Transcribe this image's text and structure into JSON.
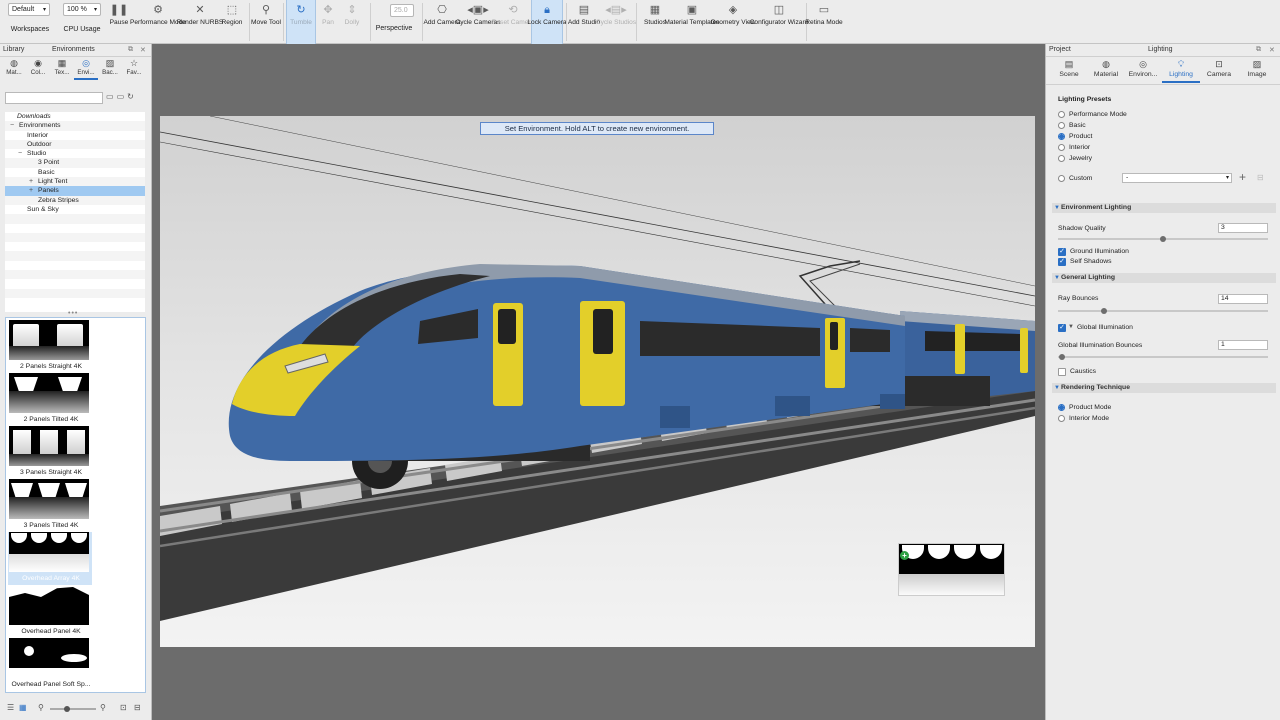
{
  "toolbar": {
    "workspace_value": "Default",
    "workspace_label": "Workspaces",
    "cpu_value": "100 %",
    "cpu_label": "CPU Usage",
    "pause": "Pause",
    "performance_mode": "Performance Mode",
    "render_nurbs": "Render NURBS",
    "region": "Region",
    "move_tool": "Move Tool",
    "tumble": "Tumble",
    "pan": "Pan",
    "dolly": "Dolly",
    "fov_value": "25.0",
    "perspective": "Perspective",
    "add_camera": "Add Camera",
    "cycle_cameras": "Cycle Cameras",
    "reset_camera": "Reset Camera",
    "lock_camera": "Lock Camera",
    "add_studio": "Add Studio",
    "cycle_studios": "Cycle Studios",
    "studios": "Studios",
    "material_templates": "Material Templates",
    "geometry_view": "Geometry View",
    "configurator_wizard": "Configurator Wizard",
    "retina_mode": "Retina Mode"
  },
  "left_panel": {
    "library_title": "Library",
    "environments_title": "Environments",
    "tabs": [
      {
        "label": "Mat...",
        "icon": "material-icon"
      },
      {
        "label": "Col...",
        "icon": "color-icon"
      },
      {
        "label": "Tex...",
        "icon": "texture-icon"
      },
      {
        "label": "Envi...",
        "icon": "globe-icon"
      },
      {
        "label": "Bac...",
        "icon": "backplate-icon"
      },
      {
        "label": "Fav...",
        "icon": "star-icon"
      }
    ],
    "tree": [
      {
        "label": "Downloads",
        "depth": 1,
        "toggle": ""
      },
      {
        "label": "Environments",
        "depth": 0,
        "toggle": "−"
      },
      {
        "label": "Interior",
        "depth": 2,
        "toggle": ""
      },
      {
        "label": "Outdoor",
        "depth": 2,
        "toggle": ""
      },
      {
        "label": "Studio",
        "depth": 2,
        "toggle": "−"
      },
      {
        "label": "3 Point",
        "depth": 3,
        "toggle": ""
      },
      {
        "label": "Basic",
        "depth": 3,
        "toggle": ""
      },
      {
        "label": "Light Tent",
        "depth": 3,
        "toggle": "+"
      },
      {
        "label": "Panels",
        "depth": 3,
        "toggle": "+",
        "selected": true
      },
      {
        "label": "Zebra Stripes",
        "depth": 3,
        "toggle": ""
      },
      {
        "label": "Sun & Sky",
        "depth": 2,
        "toggle": ""
      }
    ],
    "thumbnails": [
      {
        "label": "2 Panels Straight 4K"
      },
      {
        "label": "2 Panels Tilted 4K"
      },
      {
        "label": "3 Panels Straight 4K"
      },
      {
        "label": "3 Panels Tilted 4K"
      },
      {
        "label": "Overhead Array 4K",
        "selected": true
      },
      {
        "label": "Overhead Panel 4K"
      },
      {
        "label": "Overhead Panel Soft Sp..."
      }
    ]
  },
  "viewport": {
    "tooltip": "Set Environment. Hold ALT to create new environment.",
    "body_color": "#3f6aa6",
    "door_color": "#e3cf2a"
  },
  "right_panel": {
    "project_title": "Project",
    "lighting_title": "Lighting",
    "tabs": [
      {
        "label": "Scene",
        "icon": "scene-icon"
      },
      {
        "label": "Material",
        "icon": "material-icon"
      },
      {
        "label": "Environ...",
        "icon": "environment-icon"
      },
      {
        "label": "Lighting",
        "icon": "bulb-icon",
        "active": true
      },
      {
        "label": "Camera",
        "icon": "camera-icon"
      },
      {
        "label": "Image",
        "icon": "image-icon"
      }
    ],
    "presets_title": "Lighting Presets",
    "presets": [
      "Performance Mode",
      "Basic",
      "Product",
      "Interior",
      "Jewelry"
    ],
    "preset_selected": "Product",
    "custom_label": "Custom",
    "custom_value": "-",
    "env_lighting_title": "Environment Lighting",
    "shadow_quality_label": "Shadow Quality",
    "shadow_quality_value": "3",
    "shadow_quality_level": 0.5,
    "ground_illumination": "Ground Illumination",
    "self_shadows": "Self Shadows",
    "general_lighting_title": "General Lighting",
    "ray_bounces_label": "Ray Bounces",
    "ray_bounces_value": "14",
    "ray_bounces_level": 0.22,
    "global_illumination": "Global Illumination",
    "gi_bounces_label": "Global Illumination Bounces",
    "gi_bounces_value": "1",
    "gi_bounces_level": 0.02,
    "caustics": "Caustics",
    "rendering_technique_title": "Rendering Technique",
    "techniques": [
      "Product Mode",
      "Interior Mode"
    ],
    "technique_selected": "Product Mode",
    "accent": "#2a6fc4"
  }
}
